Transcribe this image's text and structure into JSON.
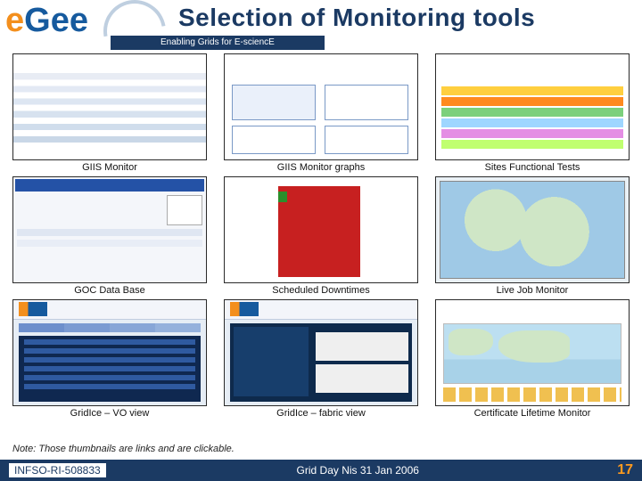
{
  "header": {
    "logo_text": "eGee",
    "tagline": "Enabling Grids for E-sciencE",
    "title": "Selection of Monitoring tools"
  },
  "grid": {
    "row1": [
      {
        "caption": "GIIS Monitor"
      },
      {
        "caption": "GIIS Monitor graphs"
      },
      {
        "caption": "Sites Functional Tests"
      }
    ],
    "row2": [
      {
        "caption": "GOC Data Base"
      },
      {
        "caption": "Scheduled Downtimes"
      },
      {
        "caption": "Live Job Monitor"
      }
    ],
    "row3": [
      {
        "caption": "GridIce – VO view"
      },
      {
        "caption": "GridIce – fabric view"
      },
      {
        "caption": "Certificate Lifetime Monitor"
      }
    ]
  },
  "note": "Note: Those thumbnails are links and are clickable.",
  "footer": {
    "left": "INFSO-RI-508833",
    "mid": "Grid Day Nis 31 Jan 2006",
    "page": "17"
  }
}
